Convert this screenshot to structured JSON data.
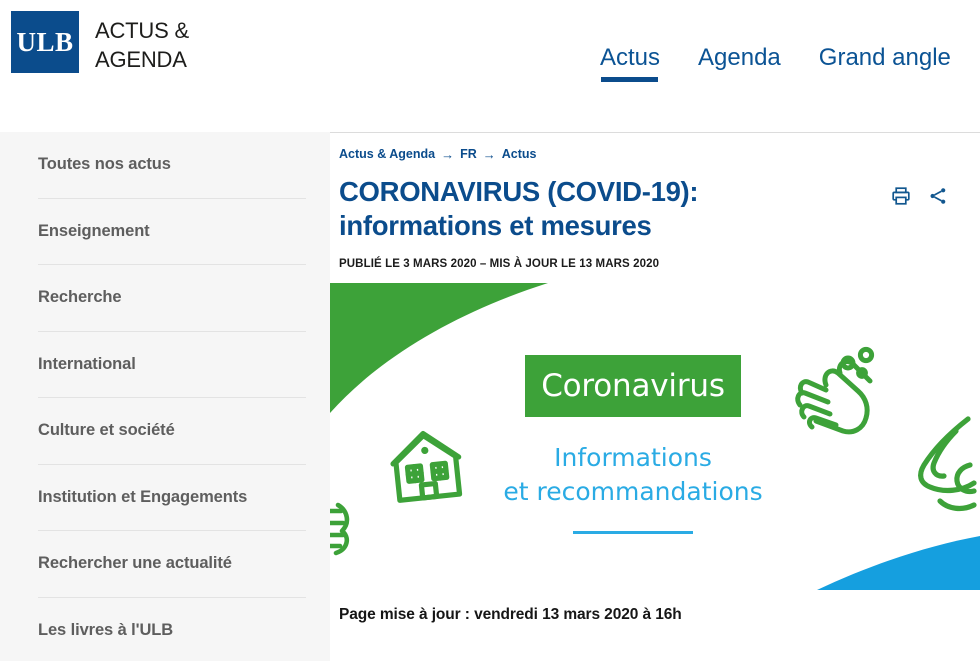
{
  "header": {
    "logo_text": "ULB",
    "site_title": "ACTUS &\nAGENDA",
    "nav": [
      {
        "label": "Actus",
        "active": true
      },
      {
        "label": "Agenda",
        "active": false
      },
      {
        "label": "Grand angle",
        "active": false
      }
    ]
  },
  "sidebar": {
    "items": [
      {
        "label": "Toutes nos actus"
      },
      {
        "label": "Enseignement"
      },
      {
        "label": "Recherche"
      },
      {
        "label": "International"
      },
      {
        "label": "Culture et société"
      },
      {
        "label": "Institution et Engagements"
      },
      {
        "label": "Rechercher une actualité"
      },
      {
        "label": "Les livres à l'ULB"
      }
    ]
  },
  "main": {
    "breadcrumb": [
      {
        "label": "Actus & Agenda"
      },
      {
        "label": "FR"
      },
      {
        "label": "Actus"
      }
    ],
    "breadcrumb_separator": "→",
    "title": "CORONAVIRUS (COVID-19): informations et mesures",
    "publication_line": "PUBLIÉ LE 3 MARS 2020 – MIS À JOUR LE 13 MARS 2020",
    "tools": [
      {
        "name": "print-icon",
        "label": "Imprimer"
      },
      {
        "name": "share-icon",
        "label": "Partager"
      }
    ],
    "footnote": "Page mise à jour : vendredi 13 mars 2020 à 16h"
  },
  "banner": {
    "chip_label": "Coronavirus",
    "subtitle": "Informations\net recommandations",
    "icons": [
      {
        "name": "house-icon"
      },
      {
        "name": "washing-hands-icon"
      },
      {
        "name": "cough-elbow-icon"
      },
      {
        "name": "partial-left-icon"
      }
    ]
  },
  "colors": {
    "brand_blue": "#0b4C8C",
    "link_blue": "#0b5394",
    "green": "#3da239",
    "light_blue": "#2aabe4",
    "sidebar_bg": "#f6f6f6",
    "sidebar_text": "#5e5e5e",
    "divider": "#e3e3e3"
  }
}
